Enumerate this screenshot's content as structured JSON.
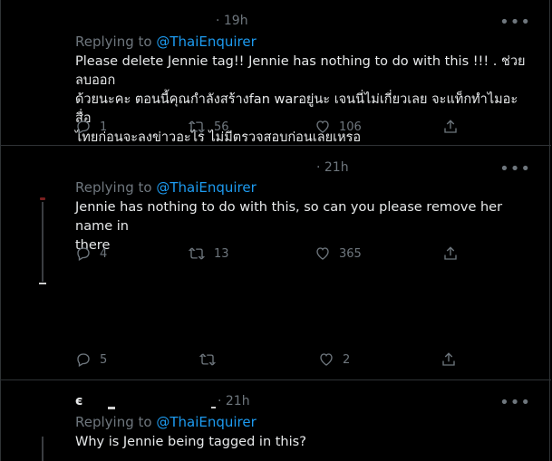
{
  "tweets": [
    {
      "time": "· 19h",
      "replying_label": "Replying to ",
      "mention": "@ThaiEnquirer",
      "text_line1": "Please delete Jennie tag!! Jennie has nothing to do with this !!! . ช่วยลบออก",
      "text_line2": "ด้วยนะคะ ตอนนี้คุณกำลังสร้างfan warอยู่นะ เจนนี่ไม่เกี่ยวเลย จะแท็กทำไมอะ สื่อ",
      "text_line3": "ไทยก่อนจะลงข่าวอะไร ไม่มีตรวจสอบก่อนเลยเหรอ",
      "replies": "1",
      "retweets": "56",
      "likes": "106",
      "more": "•••"
    },
    {
      "time": "· 21h",
      "replying_label": "Replying to ",
      "mention": "@ThaiEnquirer",
      "text_line1": "Jennie has nothing to do with this,  so can you please remove her name in",
      "text_line2": "there",
      "replies": "4",
      "retweets": "13",
      "likes": "365",
      "more": "•••"
    },
    {
      "replies": "5",
      "retweets": "",
      "likes": "2",
      "more": ""
    },
    {
      "handle_fragment": "є",
      "time": "· 21h",
      "replying_label": "Replying to ",
      "mention": "@ThaiEnquirer",
      "text_line1": "Why is Jennie being tagged in this?",
      "more": "•••"
    }
  ],
  "colors": {
    "background": "#000000",
    "text": "#e7e9ea",
    "muted": "#6e767d",
    "link": "#1d9bf0",
    "divider": "#2f3336"
  },
  "icons": [
    "reply-icon",
    "retweet-icon",
    "like-icon",
    "share-icon",
    "more-icon"
  ]
}
